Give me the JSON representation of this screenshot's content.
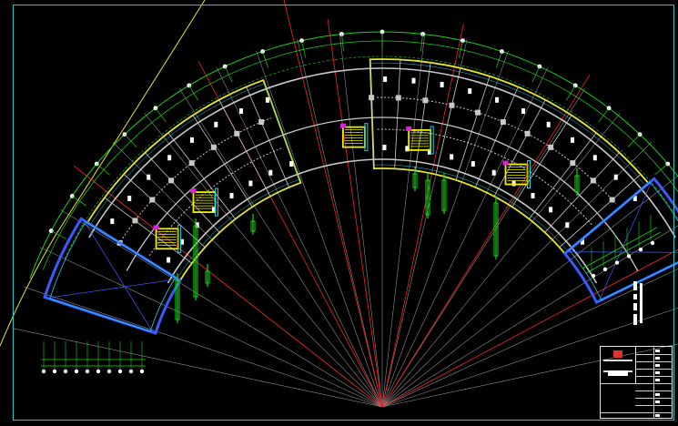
{
  "drawing": {
    "colors": {
      "background": "#000000",
      "frame": "#22c7c7",
      "grid_axis": "#18d418",
      "wall_outline": "#e6e62a",
      "structure": "#c8c8c8",
      "ray": "#b0b0b0",
      "ray_highlight": "#e02020",
      "glazing": "#3a5cff",
      "stair": "#f0f000",
      "annotation": "#18d418",
      "accent_magenta": "#e020e0",
      "accent_cyan": "#20d0e0",
      "title_block": "#e8e8e8",
      "logo": "#e03030"
    },
    "geometry_description": {
      "plan_type": "curved fan-shaped floor plan",
      "wings": 2,
      "radial_rays": true
    }
  },
  "title_block": {
    "visible": true
  }
}
